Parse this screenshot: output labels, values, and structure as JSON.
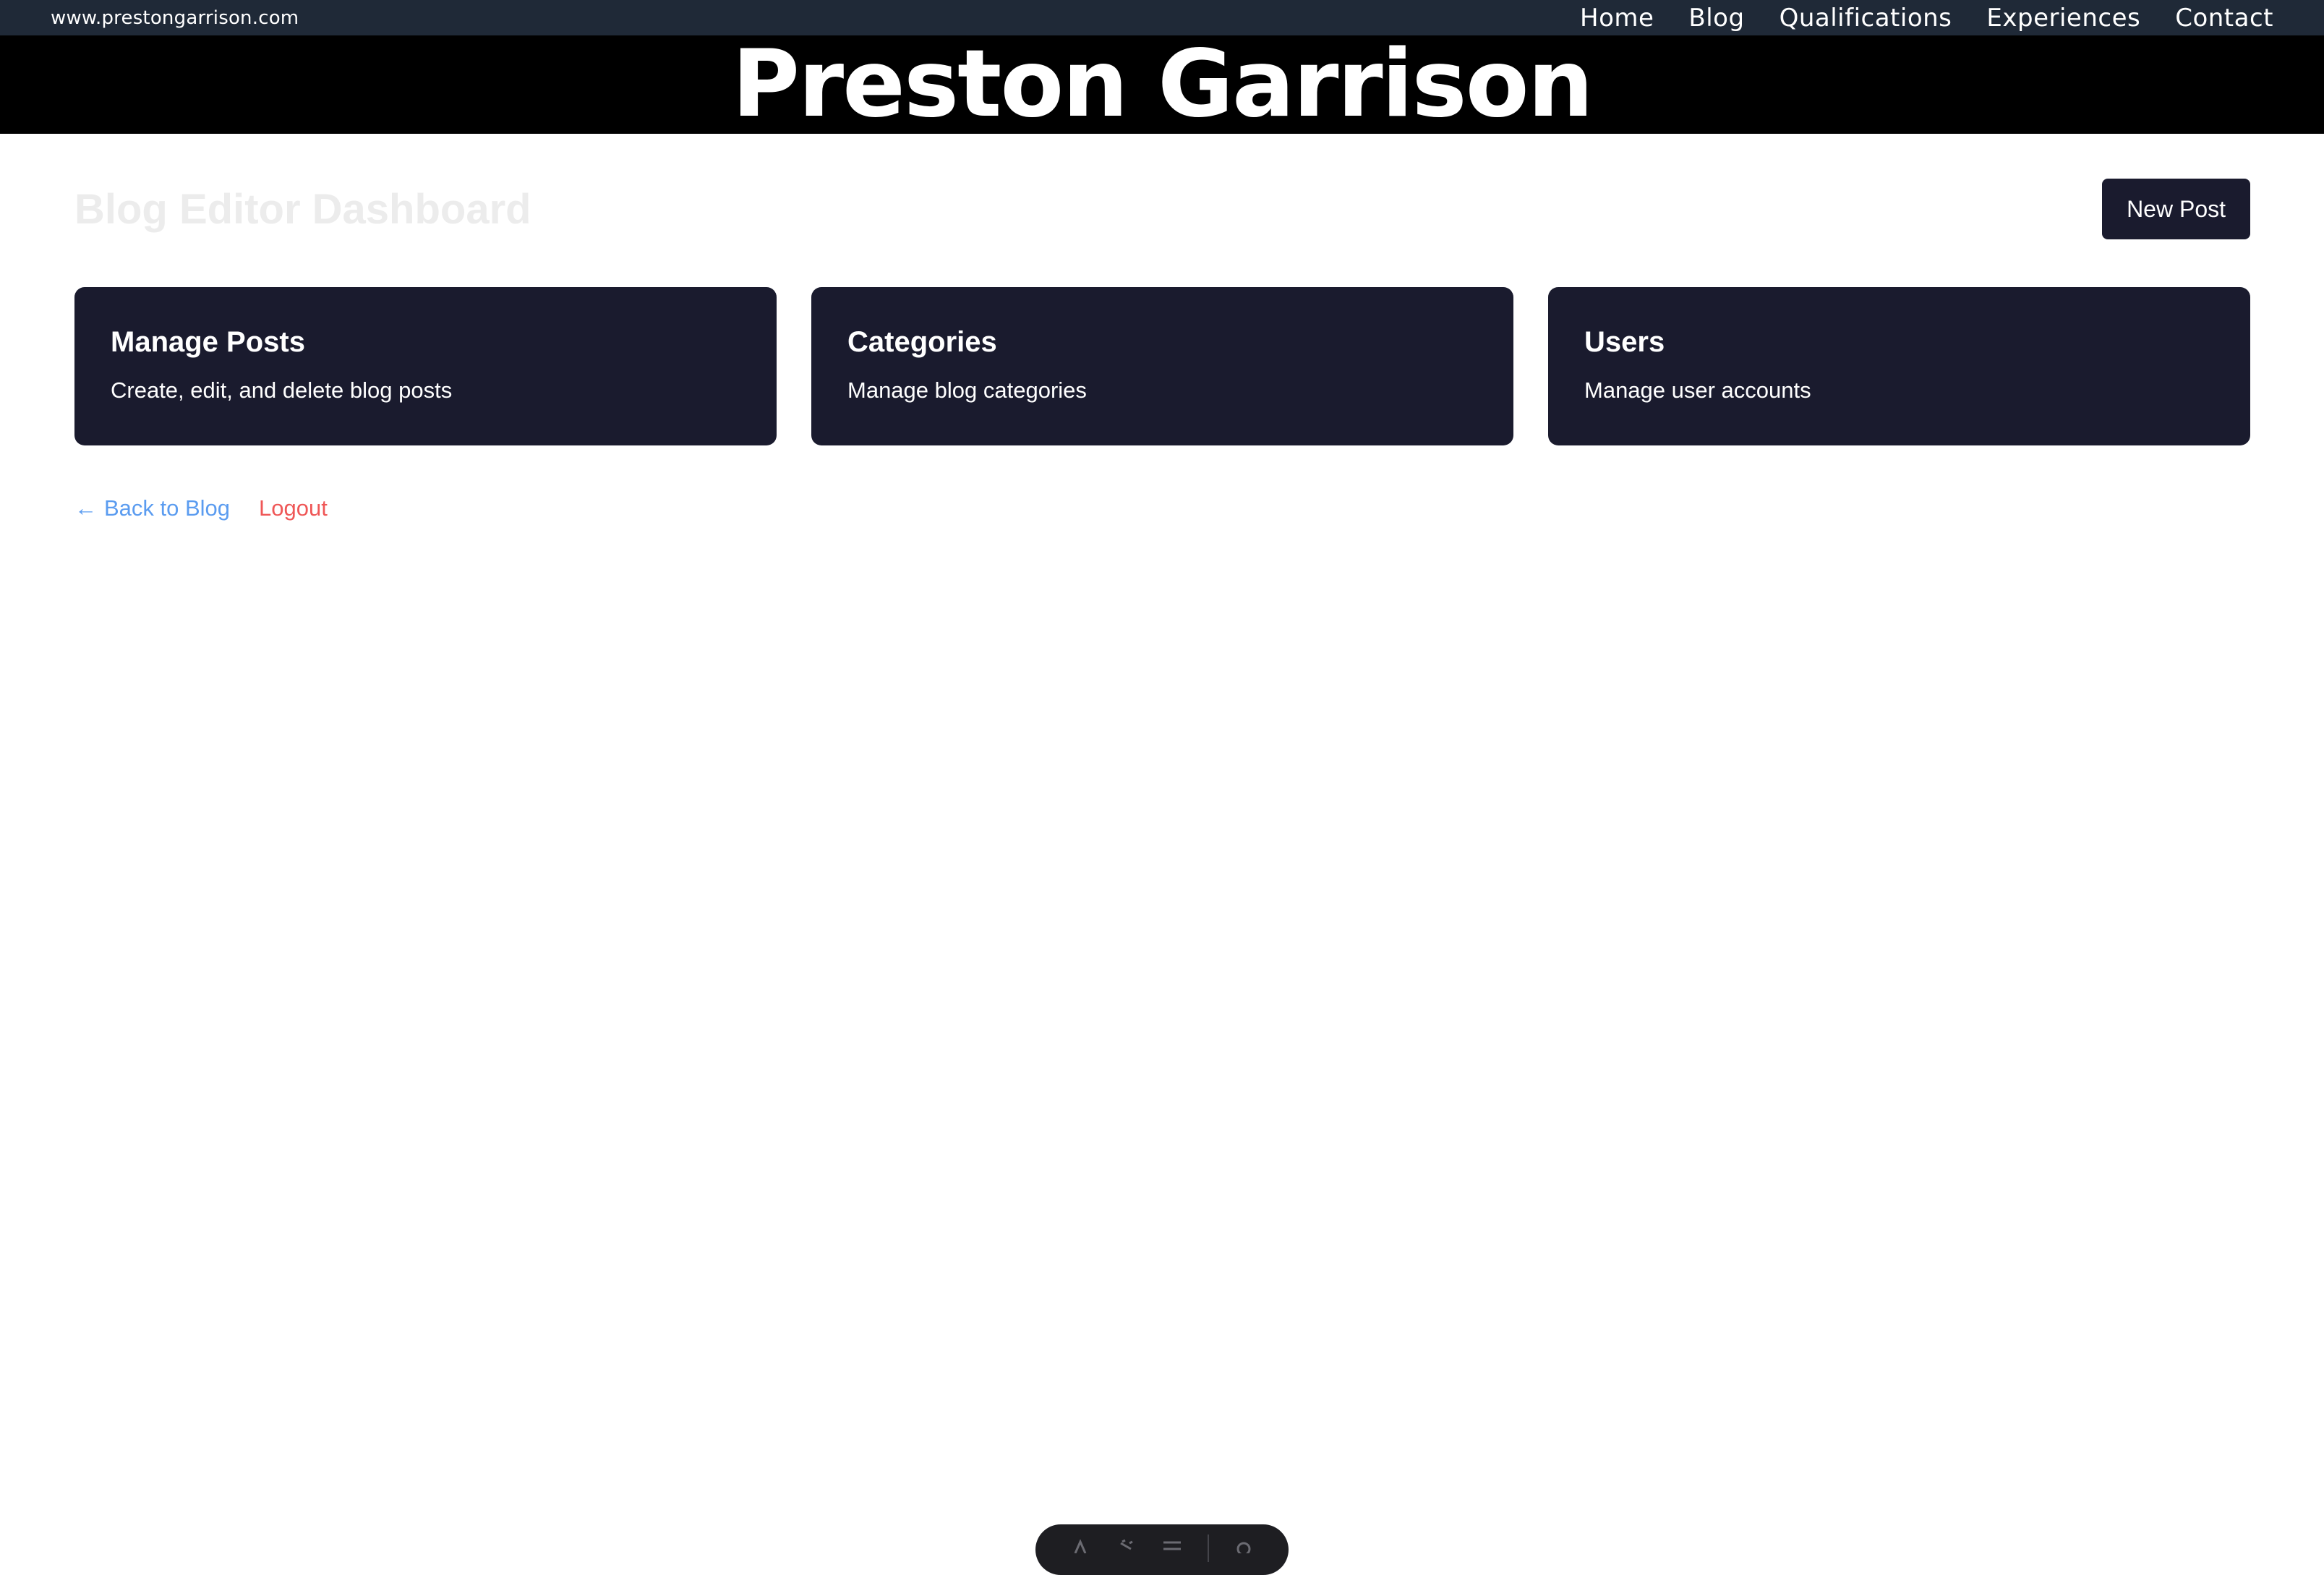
{
  "topbar": {
    "site_url": "www.prestongarrison.com",
    "nav": [
      "Home",
      "Blog",
      "Qualifications",
      "Experiences",
      "Contact"
    ]
  },
  "header": {
    "brand": "Preston Garrison"
  },
  "main": {
    "title": "Blog Editor Dashboard",
    "new_post_label": "New Post",
    "cards": [
      {
        "title": "Manage Posts",
        "description": "Create, edit, and delete blog posts"
      },
      {
        "title": "Categories",
        "description": "Manage blog categories"
      },
      {
        "title": "Users",
        "description": "Manage user accounts"
      }
    ],
    "back_arrow": "←",
    "back_label": "Back to Blog",
    "logout_label": "Logout"
  },
  "floating_toolbar": {
    "icons": [
      "inspect-icon",
      "pointer-icon",
      "menu-icon",
      "settings-icon"
    ]
  },
  "colors": {
    "topbar_bg": "#1f2937",
    "header_bg": "#000000",
    "card_bg": "#1a1b2e",
    "link_blue": "#5b9cf0",
    "link_red": "#ef5757"
  }
}
